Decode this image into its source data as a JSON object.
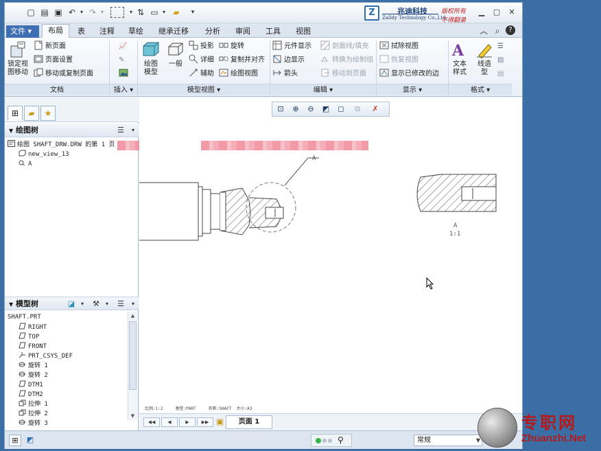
{
  "app": {
    "brand": {
      "logo_text": "Z",
      "name_cn": "兆迪科技",
      "name_en": "Zalldy Technology Co.,Ltd.",
      "slogan_1": "版权所有",
      "slogan_2": "不得翻录"
    }
  },
  "tabs": [
    {
      "label": "文件",
      "arrow": "▾"
    },
    {
      "label": "布局"
    },
    {
      "label": "表"
    },
    {
      "label": "注释"
    },
    {
      "label": "草绘"
    },
    {
      "label": "继承迁移"
    },
    {
      "label": "分析"
    },
    {
      "label": "审阅"
    },
    {
      "label": "工具"
    },
    {
      "label": "视图"
    }
  ],
  "ribbon": {
    "doc": {
      "lock_view_move": "锁定视\n图移动",
      "new_page": "新页面",
      "page_setup": "页面设置",
      "move_copy_page": "移动或复制页面",
      "group_label": "文档"
    },
    "insert": {
      "group_label": "插入 ▾"
    },
    "model_views": {
      "drawing_model": "绘图\n模型",
      "general": "一般",
      "projection": "投影",
      "detail": "详细",
      "auxiliary": "辅助",
      "revolve": "旋转",
      "copy_align": "复制并对齐",
      "drawing_view": "绘图视图",
      "group_label": "模型视图 ▾"
    },
    "edit": {
      "element_display": "元件显示",
      "edge_display": "边显示",
      "arrow": "箭头",
      "section_line_fill": "剖面线/填充",
      "convert_to_draw_group": "转换为绘制组",
      "move_to_page": "移动到页面",
      "group_label": "编辑 ▾"
    },
    "display": {
      "erase_view": "拭除视图",
      "restore_view": "恢复视图",
      "show_modified_edges": "显示已修改的边",
      "group_label": "显示 ▾"
    },
    "format": {
      "text_style": "文本\n样式",
      "line_style": "线造\n型",
      "group_label": "格式 ▾"
    }
  },
  "left_panel": {
    "drawing_tree": {
      "title": "绘图树",
      "nodes": [
        "绘图 SHAFT_DRW.DRW 的第 1 页",
        "new_view_13",
        "A"
      ]
    },
    "model_tree": {
      "title": "模型树",
      "nodes": [
        "SHAFT.PRT",
        "RIGHT",
        "TOP",
        "FRONT",
        "PRT_CSYS_DEF",
        "旋转 1",
        "旋转 2",
        "DTM1",
        "DTM2",
        "拉伸 1",
        "拉伸 2",
        "旋转 3"
      ]
    }
  },
  "canvas": {
    "detail_label": "A",
    "detail_view_label": "A",
    "detail_scale": "1:1",
    "footer_text": "比例:1:2     类型:PART     名称:SHAFT  大小:A3"
  },
  "bottombar": {
    "page_tab": "页面 1"
  },
  "status": {
    "selection_filter": "常规"
  },
  "watermark": {
    "cn": "专职网",
    "en": "Zhuanzhi.Net"
  },
  "colors": {
    "accent": "#3e6fb2",
    "desktop": "#3a6ea5",
    "redaction": "#f08896",
    "watermark_red": "#b41a1a"
  }
}
